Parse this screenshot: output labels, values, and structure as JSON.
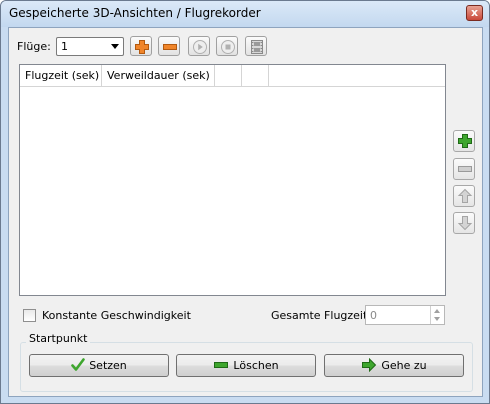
{
  "window": {
    "title": "Gespeicherte 3D-Ansichten / Flugrekorder",
    "close_glyph": "x"
  },
  "toolbar": {
    "fluege_label": "Flüge:",
    "fluege_value": "1",
    "icons": [
      "add-icon",
      "remove-icon",
      "play-icon",
      "stop-icon",
      "film-icon"
    ]
  },
  "table": {
    "columns": [
      "Flugzeit (sek)",
      "Verweildauer (sek)",
      "",
      ""
    ],
    "rows": []
  },
  "side": {
    "icons": [
      "add-icon",
      "remove-icon",
      "arrow-up-icon",
      "arrow-down-icon"
    ]
  },
  "options": {
    "const_speed_label": "Konstante Geschwindigkeit",
    "const_speed_checked": false,
    "total_time_label": "Gesamte Flugzeit:",
    "total_time_value": "0"
  },
  "startpoint": {
    "title": "Startpunkt",
    "set_label": "Setzen",
    "delete_label": "Löschen",
    "goto_label": "Gehe zu"
  },
  "colors": {
    "accent_orange": "#f0852a",
    "accent_green": "#3ea62e",
    "window_frame": "#c9dcf1"
  }
}
